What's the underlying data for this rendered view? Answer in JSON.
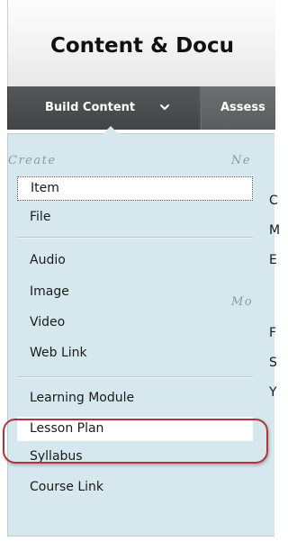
{
  "header": {
    "title": "Content & Docu"
  },
  "toolbar": {
    "build_content_label": "Build Content",
    "build_content_icon": "chevron-down-icon",
    "assessments_label": "Assess"
  },
  "menu": {
    "create_header": "Create",
    "right_header_new": "Ne",
    "right_header_more": "Mo",
    "items": [
      {
        "label": "Item"
      },
      {
        "label": "File"
      },
      {
        "label": "Audio"
      },
      {
        "label": "Image"
      },
      {
        "label": "Video"
      },
      {
        "label": "Web Link"
      },
      {
        "label": "Learning Module"
      },
      {
        "label": "Lesson Plan"
      },
      {
        "label": "Syllabus"
      },
      {
        "label": "Course Link"
      }
    ],
    "right_letters": [
      "C",
      "M",
      "E",
      "F",
      "S",
      "Y"
    ]
  },
  "colors": {
    "panel_bg": "#d6e8ed",
    "toolbar_bg": "#4a4c4d",
    "annotation_ring": "#b0343b"
  }
}
